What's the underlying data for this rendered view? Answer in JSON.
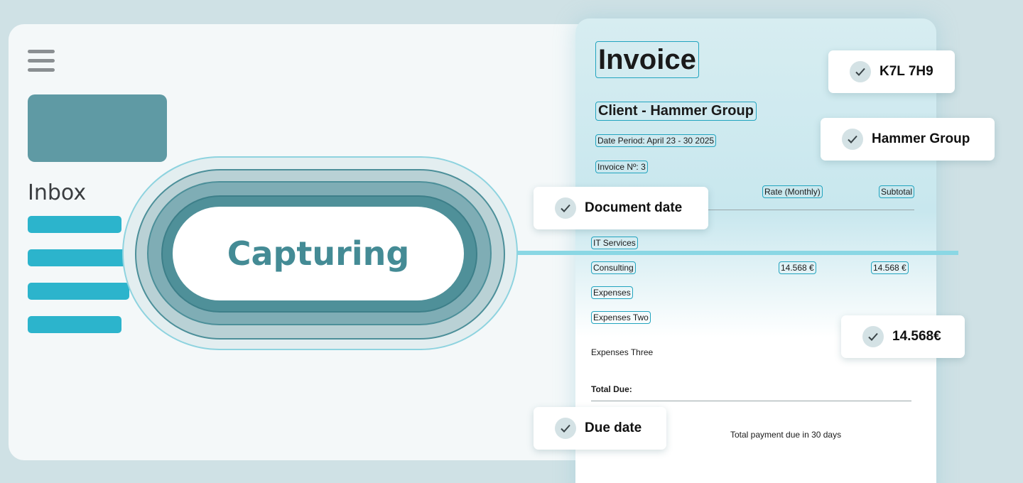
{
  "sidebar": {
    "inbox_label": "Inbox",
    "inbox_item_count": 4
  },
  "capture": {
    "label": "Capturing"
  },
  "invoice": {
    "title": "Invoice",
    "client": "Client - Hammer Group",
    "date_period": "Date Period: April 23 - 30 2025",
    "invoice_number": "Invoice Nº: 3",
    "columns": {
      "rate": "Rate (Monthly)",
      "subtotal": "Subtotal"
    },
    "items": [
      {
        "name": "IT Services",
        "rate": "",
        "subtotal": ""
      },
      {
        "name": "Consulting",
        "rate": "14.568 €",
        "subtotal": "14.568 €"
      },
      {
        "name": "Expenses",
        "rate": "",
        "subtotal": ""
      },
      {
        "name": "Expenses Two",
        "rate": "",
        "subtotal": ""
      },
      {
        "name": "Expenses Three",
        "rate": "",
        "subtotal": ""
      }
    ],
    "total_label": "Total Due:",
    "payment_note": "Total payment due in 30 days"
  },
  "extracted_fields": {
    "postal_code": "K7L 7H9",
    "company": "Hammer Group",
    "document_date": "Document date",
    "amount": "14.568€",
    "due_date": "Due date"
  },
  "colors": {
    "accent": "#2cb4cc",
    "teal_dark": "#4c8f99",
    "capture_text": "#448b95",
    "background": "#cfe1e5"
  }
}
